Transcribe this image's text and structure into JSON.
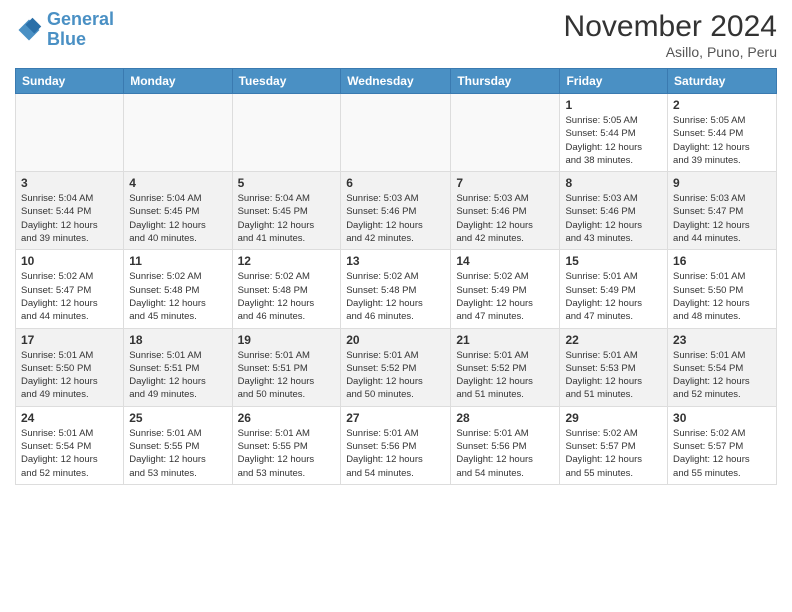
{
  "header": {
    "logo_line1": "General",
    "logo_line2": "Blue",
    "month": "November 2024",
    "location": "Asillo, Puno, Peru"
  },
  "weekdays": [
    "Sunday",
    "Monday",
    "Tuesday",
    "Wednesday",
    "Thursday",
    "Friday",
    "Saturday"
  ],
  "weeks": [
    [
      {
        "day": "",
        "info": ""
      },
      {
        "day": "",
        "info": ""
      },
      {
        "day": "",
        "info": ""
      },
      {
        "day": "",
        "info": ""
      },
      {
        "day": "",
        "info": ""
      },
      {
        "day": "1",
        "info": "Sunrise: 5:05 AM\nSunset: 5:44 PM\nDaylight: 12 hours\nand 38 minutes."
      },
      {
        "day": "2",
        "info": "Sunrise: 5:05 AM\nSunset: 5:44 PM\nDaylight: 12 hours\nand 39 minutes."
      }
    ],
    [
      {
        "day": "3",
        "info": "Sunrise: 5:04 AM\nSunset: 5:44 PM\nDaylight: 12 hours\nand 39 minutes."
      },
      {
        "day": "4",
        "info": "Sunrise: 5:04 AM\nSunset: 5:45 PM\nDaylight: 12 hours\nand 40 minutes."
      },
      {
        "day": "5",
        "info": "Sunrise: 5:04 AM\nSunset: 5:45 PM\nDaylight: 12 hours\nand 41 minutes."
      },
      {
        "day": "6",
        "info": "Sunrise: 5:03 AM\nSunset: 5:46 PM\nDaylight: 12 hours\nand 42 minutes."
      },
      {
        "day": "7",
        "info": "Sunrise: 5:03 AM\nSunset: 5:46 PM\nDaylight: 12 hours\nand 42 minutes."
      },
      {
        "day": "8",
        "info": "Sunrise: 5:03 AM\nSunset: 5:46 PM\nDaylight: 12 hours\nand 43 minutes."
      },
      {
        "day": "9",
        "info": "Sunrise: 5:03 AM\nSunset: 5:47 PM\nDaylight: 12 hours\nand 44 minutes."
      }
    ],
    [
      {
        "day": "10",
        "info": "Sunrise: 5:02 AM\nSunset: 5:47 PM\nDaylight: 12 hours\nand 44 minutes."
      },
      {
        "day": "11",
        "info": "Sunrise: 5:02 AM\nSunset: 5:48 PM\nDaylight: 12 hours\nand 45 minutes."
      },
      {
        "day": "12",
        "info": "Sunrise: 5:02 AM\nSunset: 5:48 PM\nDaylight: 12 hours\nand 46 minutes."
      },
      {
        "day": "13",
        "info": "Sunrise: 5:02 AM\nSunset: 5:48 PM\nDaylight: 12 hours\nand 46 minutes."
      },
      {
        "day": "14",
        "info": "Sunrise: 5:02 AM\nSunset: 5:49 PM\nDaylight: 12 hours\nand 47 minutes."
      },
      {
        "day": "15",
        "info": "Sunrise: 5:01 AM\nSunset: 5:49 PM\nDaylight: 12 hours\nand 47 minutes."
      },
      {
        "day": "16",
        "info": "Sunrise: 5:01 AM\nSunset: 5:50 PM\nDaylight: 12 hours\nand 48 minutes."
      }
    ],
    [
      {
        "day": "17",
        "info": "Sunrise: 5:01 AM\nSunset: 5:50 PM\nDaylight: 12 hours\nand 49 minutes."
      },
      {
        "day": "18",
        "info": "Sunrise: 5:01 AM\nSunset: 5:51 PM\nDaylight: 12 hours\nand 49 minutes."
      },
      {
        "day": "19",
        "info": "Sunrise: 5:01 AM\nSunset: 5:51 PM\nDaylight: 12 hours\nand 50 minutes."
      },
      {
        "day": "20",
        "info": "Sunrise: 5:01 AM\nSunset: 5:52 PM\nDaylight: 12 hours\nand 50 minutes."
      },
      {
        "day": "21",
        "info": "Sunrise: 5:01 AM\nSunset: 5:52 PM\nDaylight: 12 hours\nand 51 minutes."
      },
      {
        "day": "22",
        "info": "Sunrise: 5:01 AM\nSunset: 5:53 PM\nDaylight: 12 hours\nand 51 minutes."
      },
      {
        "day": "23",
        "info": "Sunrise: 5:01 AM\nSunset: 5:54 PM\nDaylight: 12 hours\nand 52 minutes."
      }
    ],
    [
      {
        "day": "24",
        "info": "Sunrise: 5:01 AM\nSunset: 5:54 PM\nDaylight: 12 hours\nand 52 minutes."
      },
      {
        "day": "25",
        "info": "Sunrise: 5:01 AM\nSunset: 5:55 PM\nDaylight: 12 hours\nand 53 minutes."
      },
      {
        "day": "26",
        "info": "Sunrise: 5:01 AM\nSunset: 5:55 PM\nDaylight: 12 hours\nand 53 minutes."
      },
      {
        "day": "27",
        "info": "Sunrise: 5:01 AM\nSunset: 5:56 PM\nDaylight: 12 hours\nand 54 minutes."
      },
      {
        "day": "28",
        "info": "Sunrise: 5:01 AM\nSunset: 5:56 PM\nDaylight: 12 hours\nand 54 minutes."
      },
      {
        "day": "29",
        "info": "Sunrise: 5:02 AM\nSunset: 5:57 PM\nDaylight: 12 hours\nand 55 minutes."
      },
      {
        "day": "30",
        "info": "Sunrise: 5:02 AM\nSunset: 5:57 PM\nDaylight: 12 hours\nand 55 minutes."
      }
    ]
  ]
}
